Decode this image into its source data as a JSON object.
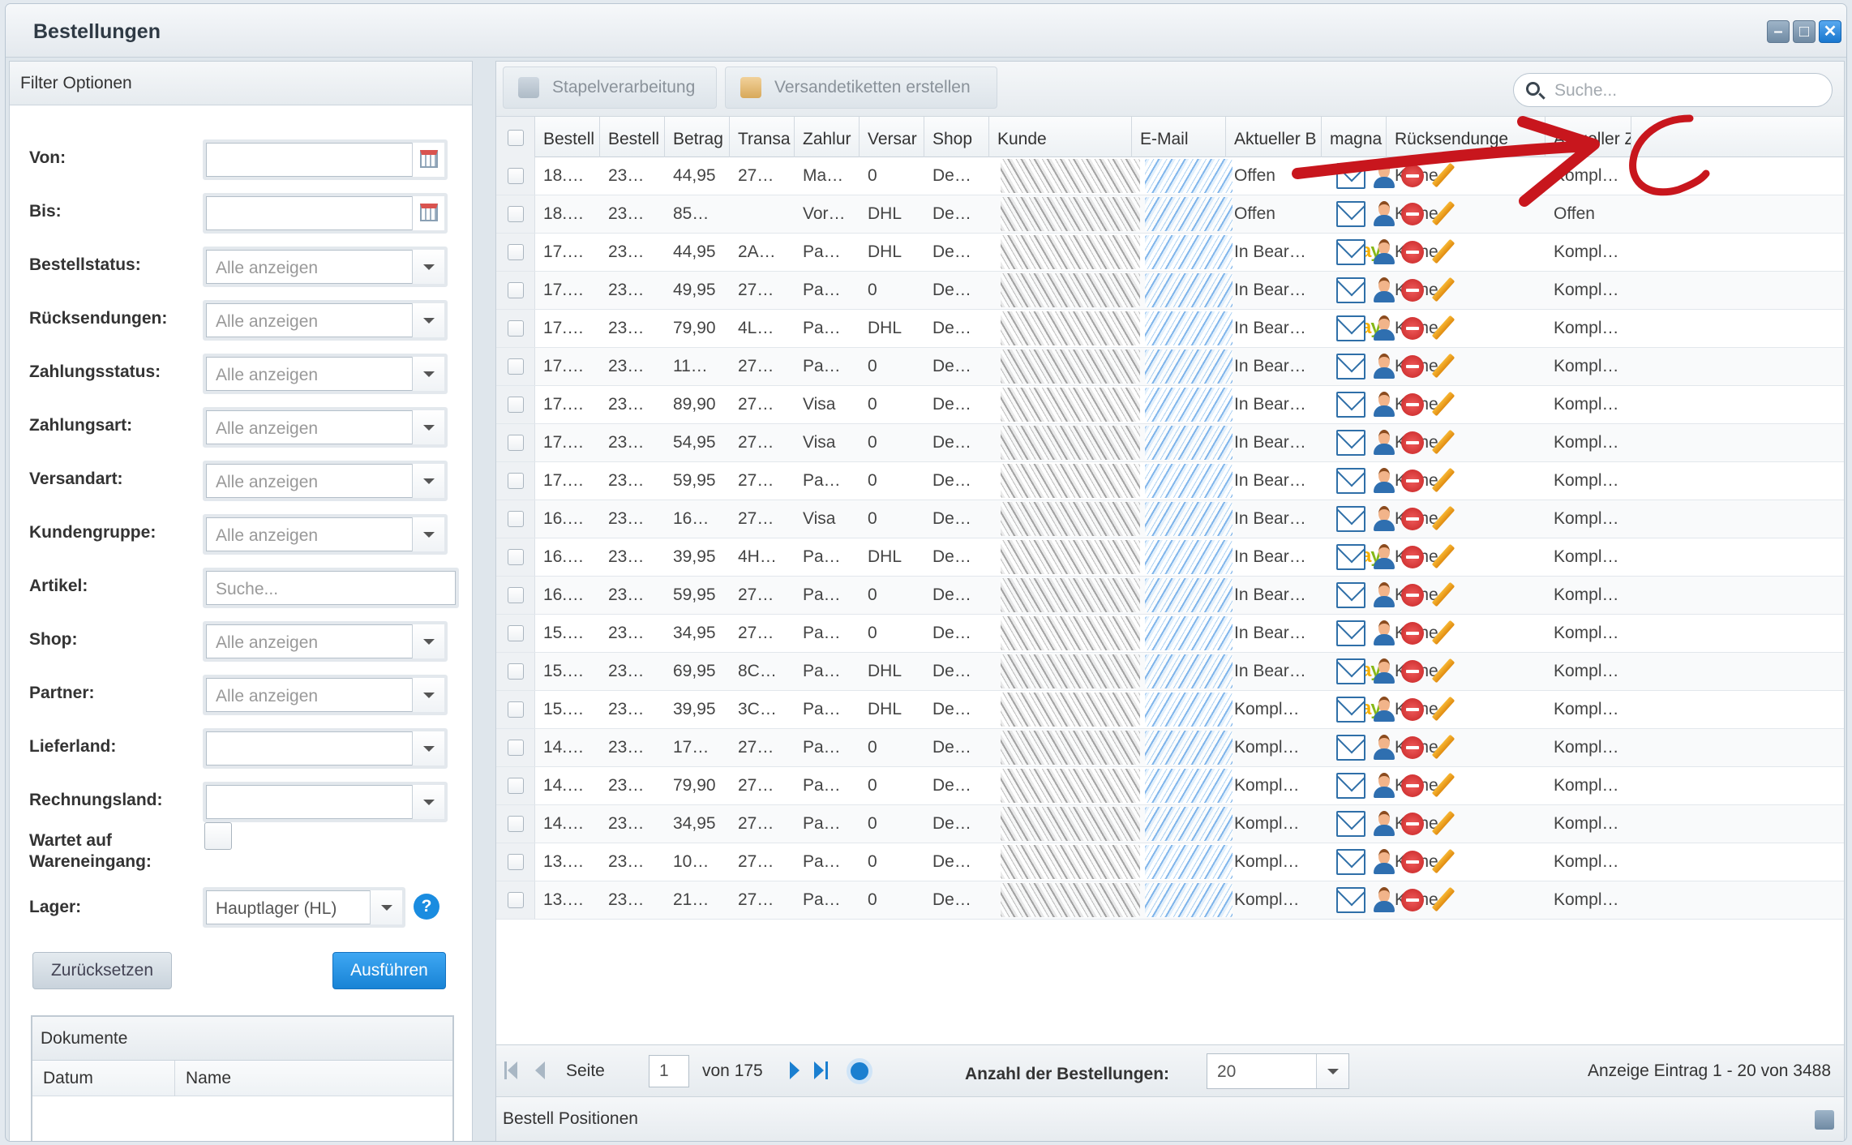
{
  "window": {
    "title": "Bestellungen",
    "controls": [
      "minimize",
      "maximize",
      "close"
    ]
  },
  "filters": {
    "title": "Filter Optionen",
    "von_label": "Von:",
    "bis_label": "Bis:",
    "bestellstatus_label": "Bestellstatus:",
    "bestellstatus_value": "Alle anzeigen",
    "ruecksendungen_label": "Rücksendungen:",
    "ruecksendungen_value": "Alle anzeigen",
    "zahlungsstatus_label": "Zahlungsstatus:",
    "zahlungsstatus_value": "Alle anzeigen",
    "zahlungsart_label": "Zahlungsart:",
    "zahlungsart_value": "Alle anzeigen",
    "versandart_label": "Versandart:",
    "versandart_value": "Alle anzeigen",
    "kundengruppe_label": "Kundengruppe:",
    "kundengruppe_value": "Alle anzeigen",
    "artikel_label": "Artikel:",
    "artikel_placeholder": "Suche...",
    "shop_label": "Shop:",
    "shop_value": "Alle anzeigen",
    "partner_label": "Partner:",
    "partner_value": "Alle anzeigen",
    "lieferland_label": "Lieferland:",
    "rechnungsland_label": "Rechnungsland:",
    "wartet_label_1": "Wartet auf",
    "wartet_label_2": "Wareneingang:",
    "lager_label": "Lager:",
    "lager_value": "Hauptlager (HL)",
    "help_icon": "?",
    "reset_label": "Zurücksetzen",
    "run_label": "Ausführen"
  },
  "documents": {
    "title": "Dokumente",
    "col_datum": "Datum",
    "col_name": "Name"
  },
  "toolbar": {
    "batch_label": "Stapelverarbeitung",
    "labels_label": "Versandetiketten erstellen",
    "search_placeholder": "Suche..."
  },
  "grid": {
    "columns": [
      "Bestell",
      "Bestell",
      "Betrag",
      "Transa",
      "Zahlur",
      "Versar",
      "Shop",
      "Kunde",
      "E-Mail",
      "Aktueller B",
      "magna",
      "Rücksendunge",
      "Aktueller Z"
    ],
    "rows": [
      {
        "c1": "18.…",
        "c2": "23…",
        "amount": "44,95",
        "trans": "27…",
        "pay": "Ma…",
        "ship": "0",
        "shop": "De…",
        "status": "Offen",
        "ebay": false,
        "returns": "Keine",
        "payst": "Kompl…"
      },
      {
        "c1": "18.…",
        "c2": "23…",
        "amount": "85…",
        "trans": "",
        "pay": "Vor…",
        "ship": "DHL",
        "shop": "De…",
        "status": "Offen",
        "ebay": false,
        "returns": "Keine",
        "payst": "Offen"
      },
      {
        "c1": "17.…",
        "c2": "23…",
        "amount": "44,95",
        "trans": "2A…",
        "pay": "Pa…",
        "ship": "DHL",
        "shop": "De…",
        "status": "In Bear…",
        "ebay": true,
        "returns": "Keine",
        "payst": "Kompl…"
      },
      {
        "c1": "17.…",
        "c2": "23…",
        "amount": "49,95",
        "trans": "27…",
        "pay": "Pa…",
        "ship": "0",
        "shop": "De…",
        "status": "In Bear…",
        "ebay": false,
        "returns": "Keine",
        "payst": "Kompl…"
      },
      {
        "c1": "17.…",
        "c2": "23…",
        "amount": "79,90",
        "trans": "4L…",
        "pay": "Pa…",
        "ship": "DHL",
        "shop": "De…",
        "status": "In Bear…",
        "ebay": true,
        "returns": "Keine",
        "payst": "Kompl…"
      },
      {
        "c1": "17.…",
        "c2": "23…",
        "amount": "11…",
        "trans": "27…",
        "pay": "Pa…",
        "ship": "0",
        "shop": "De…",
        "status": "In Bear…",
        "ebay": false,
        "returns": "Keine",
        "payst": "Kompl…"
      },
      {
        "c1": "17.…",
        "c2": "23…",
        "amount": "89,90",
        "trans": "27…",
        "pay": "Visa",
        "ship": "0",
        "shop": "De…",
        "status": "In Bear…",
        "ebay": false,
        "returns": "Keine",
        "payst": "Kompl…"
      },
      {
        "c1": "17.…",
        "c2": "23…",
        "amount": "54,95",
        "trans": "27…",
        "pay": "Visa",
        "ship": "0",
        "shop": "De…",
        "status": "In Bear…",
        "ebay": false,
        "returns": "Keine",
        "payst": "Kompl…"
      },
      {
        "c1": "17.…",
        "c2": "23…",
        "amount": "59,95",
        "trans": "27…",
        "pay": "Pa…",
        "ship": "0",
        "shop": "De…",
        "status": "In Bear…",
        "ebay": false,
        "returns": "Keine",
        "payst": "Kompl…"
      },
      {
        "c1": "16.…",
        "c2": "23…",
        "amount": "16…",
        "trans": "27…",
        "pay": "Visa",
        "ship": "0",
        "shop": "De…",
        "status": "In Bear…",
        "ebay": false,
        "returns": "Keine",
        "payst": "Kompl…"
      },
      {
        "c1": "16.…",
        "c2": "23…",
        "amount": "39,95",
        "trans": "4H…",
        "pay": "Pa…",
        "ship": "DHL",
        "shop": "De…",
        "status": "In Bear…",
        "ebay": true,
        "returns": "Keine",
        "payst": "Kompl…"
      },
      {
        "c1": "16.…",
        "c2": "23…",
        "amount": "59,95",
        "trans": "27…",
        "pay": "Pa…",
        "ship": "0",
        "shop": "De…",
        "status": "In Bear…",
        "ebay": false,
        "returns": "Keine",
        "payst": "Kompl…"
      },
      {
        "c1": "15.…",
        "c2": "23…",
        "amount": "34,95",
        "trans": "27…",
        "pay": "Pa…",
        "ship": "0",
        "shop": "De…",
        "status": "In Bear…",
        "ebay": false,
        "returns": "Keine",
        "payst": "Kompl…"
      },
      {
        "c1": "15.…",
        "c2": "23…",
        "amount": "69,95",
        "trans": "8C…",
        "pay": "Pa…",
        "ship": "DHL",
        "shop": "De…",
        "status": "In Bear…",
        "ebay": true,
        "returns": "Keine",
        "payst": "Kompl…"
      },
      {
        "c1": "15.…",
        "c2": "23…",
        "amount": "39,95",
        "trans": "3C…",
        "pay": "Pa…",
        "ship": "DHL",
        "shop": "De…",
        "status": "Kompl…",
        "ebay": true,
        "returns": "Keine",
        "payst": "Kompl…"
      },
      {
        "c1": "14.…",
        "c2": "23…",
        "amount": "17…",
        "trans": "27…",
        "pay": "Pa…",
        "ship": "0",
        "shop": "De…",
        "status": "Kompl…",
        "ebay": false,
        "returns": "Keine",
        "payst": "Kompl…"
      },
      {
        "c1": "14.…",
        "c2": "23…",
        "amount": "79,90",
        "trans": "27…",
        "pay": "Pa…",
        "ship": "0",
        "shop": "De…",
        "status": "Kompl…",
        "ebay": false,
        "returns": "Keine",
        "payst": "Kompl…"
      },
      {
        "c1": "14.…",
        "c2": "23…",
        "amount": "34,95",
        "trans": "27…",
        "pay": "Pa…",
        "ship": "0",
        "shop": "De…",
        "status": "Kompl…",
        "ebay": false,
        "returns": "Keine",
        "payst": "Kompl…"
      },
      {
        "c1": "13.…",
        "c2": "23…",
        "amount": "10…",
        "trans": "27…",
        "pay": "Pa…",
        "ship": "0",
        "shop": "De…",
        "status": "Kompl…",
        "ebay": false,
        "returns": "Keine",
        "payst": "Kompl…"
      },
      {
        "c1": "13.…",
        "c2": "23…",
        "amount": "21…",
        "trans": "27…",
        "pay": "Pa…",
        "ship": "0",
        "shop": "De…",
        "status": "Kompl…",
        "ebay": false,
        "returns": "Keine",
        "payst": "Kompl…"
      }
    ],
    "ebay_colors": [
      "#e53238",
      "#0064d2",
      "#f5af02",
      "#86b817"
    ]
  },
  "pager": {
    "page_label": "Seite",
    "page_value": "1",
    "of_label": "von 175",
    "count_label": "Anzahl der Bestellungen:",
    "count_value": "20",
    "display_info": "Anzeige Eintrag 1 - 20 von 3488"
  },
  "positions": {
    "title": "Bestell Positionen"
  },
  "annotation": {
    "color": "#c8161d"
  }
}
